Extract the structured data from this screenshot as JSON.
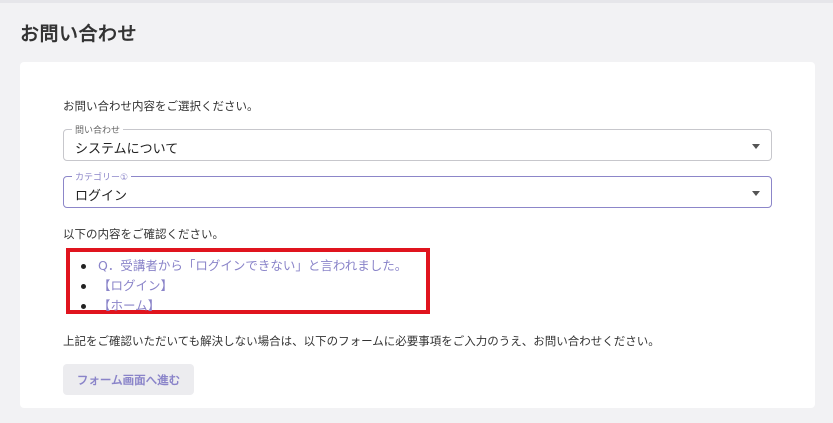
{
  "page": {
    "title": "お問い合わせ"
  },
  "form": {
    "intro": "お問い合わせ内容をご選択ください。",
    "inquiry_select": {
      "label": "問い合わせ",
      "value": "システムについて"
    },
    "category_select": {
      "label": "カテゴリー①",
      "value": "ログイン"
    },
    "confirm_text": "以下の内容をご確認ください。",
    "links": [
      {
        "label": "Q．受講者から「ログインできない」と言われました。"
      },
      {
        "label": "【ログイン】"
      },
      {
        "label": "【ホーム】"
      }
    ],
    "note": "上記をご確認いただいても解決しない場合は、以下のフォームに必要事項をご入力のうえ、お問い合わせください。",
    "submit_label": "フォーム画面へ進む"
  },
  "colors": {
    "accent": "#8a84c9",
    "highlight": "#e0141e",
    "background": "#f2f2f4"
  },
  "icons": {
    "select_caret": "chevron-down-icon"
  }
}
